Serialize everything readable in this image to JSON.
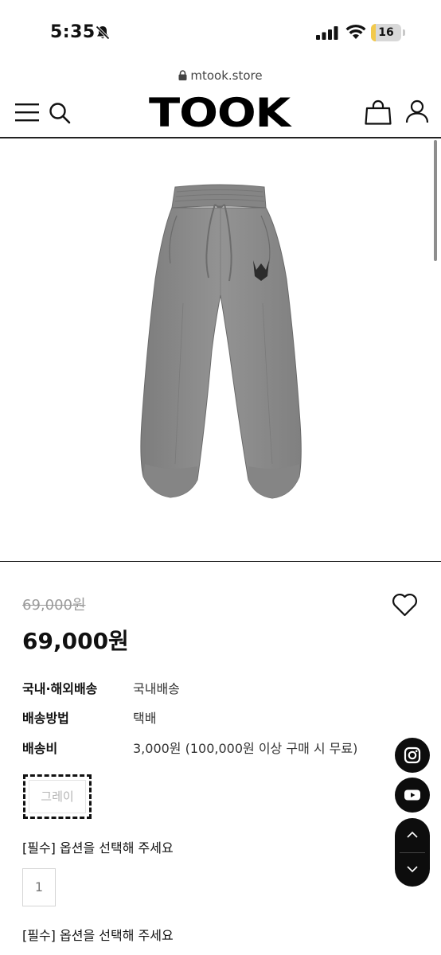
{
  "status_bar": {
    "time": "5:35",
    "battery_level": "16",
    "battery_fraction": 0.16
  },
  "browser": {
    "url": "mtook.store"
  },
  "header": {
    "logo_text": "TOOK",
    "icons": [
      "menu-icon",
      "search-icon",
      "bag-icon",
      "user-icon"
    ]
  },
  "product": {
    "original_price": "69,000원",
    "price": "69,000원"
  },
  "info": [
    {
      "label": "국내·해외배송",
      "value": "국내배송"
    },
    {
      "label": "배송방법",
      "value": "택배"
    },
    {
      "label": "배송비",
      "value": "3,000원 (100,000원 이상 구매 시 무료)"
    }
  ],
  "option": {
    "color_option": "그레이",
    "required_text_1": "[필수] 옵션을 선택해 주세요",
    "quantity": "1",
    "required_text_2": "[필수] 옵션을 선택해 주세요"
  },
  "floating": {
    "icons": [
      "instagram-icon",
      "youtube-icon",
      "chevron-up-icon",
      "chevron-down-icon"
    ]
  },
  "colors": {
    "text": "#111111",
    "muted": "#9a9a9a",
    "float_bg": "#0d0d0d",
    "pants": "#8a8a8a",
    "battery": "#f2c94c"
  }
}
